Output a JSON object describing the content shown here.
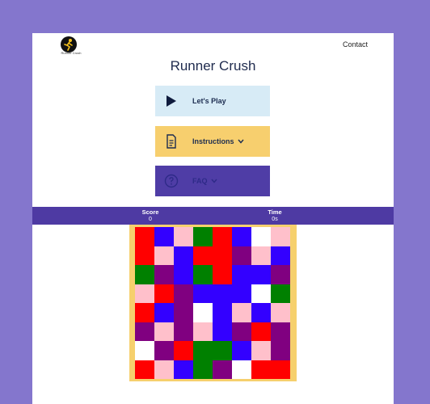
{
  "header": {
    "logo_text": "Runner Crush",
    "contact_label": "Contact"
  },
  "page": {
    "title": "Runner Crush"
  },
  "menu": {
    "play_label": "Let's Play",
    "instructions_label": "Instructions",
    "faq_label": "FAQ"
  },
  "stats": {
    "score_label": "Score",
    "score_value": "0",
    "time_label": "Time",
    "time_value": "0s"
  },
  "colors": {
    "red": "#ff0000",
    "blue": "#3300ff",
    "pink": "#ffc0cb",
    "green": "#008000",
    "purple": "#800080",
    "white": "#ffffff",
    "accent": "#4e3aa3",
    "board": "#f6d06d"
  },
  "board": [
    [
      "red",
      "blue",
      "pink",
      "green",
      "red",
      "blue",
      "white",
      "pink"
    ],
    [
      "red",
      "pink",
      "blue",
      "red",
      "red",
      "purple",
      "pink",
      "blue"
    ],
    [
      "green",
      "purple",
      "blue",
      "green",
      "red",
      "blue",
      "blue",
      "purple"
    ],
    [
      "pink",
      "red",
      "purple",
      "blue",
      "blue",
      "blue",
      "white",
      "green"
    ],
    [
      "red",
      "blue",
      "purple",
      "white",
      "blue",
      "pink",
      "blue",
      "pink"
    ],
    [
      "purple",
      "pink",
      "purple",
      "pink",
      "blue",
      "purple",
      "red",
      "purple"
    ],
    [
      "white",
      "purple",
      "red",
      "green",
      "green",
      "blue",
      "pink",
      "purple"
    ],
    [
      "red",
      "pink",
      "blue",
      "green",
      "purple",
      "white",
      "red",
      "red"
    ]
  ]
}
